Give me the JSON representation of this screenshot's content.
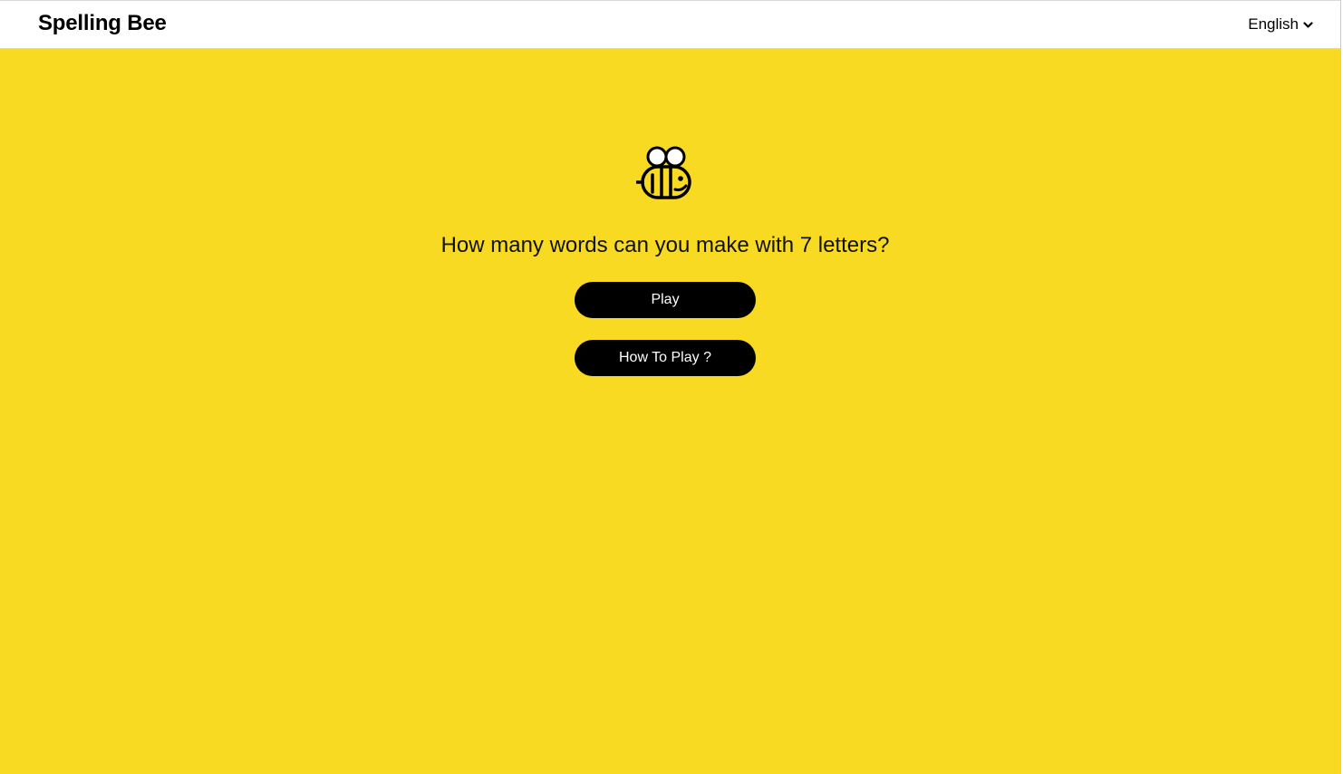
{
  "header": {
    "title": "Spelling Bee",
    "language": {
      "selected": "English",
      "icon": "chevron-down-icon"
    }
  },
  "main": {
    "logo_icon": "bee-icon",
    "tagline": "How many words can you make with 7 letters?",
    "play_label": "Play",
    "how_to_play_label": "How To Play ?"
  },
  "colors": {
    "background": "#f7da21",
    "header_bg": "#ffffff",
    "button_bg": "#000000",
    "button_text": "#ffffff",
    "text": "#111111"
  }
}
